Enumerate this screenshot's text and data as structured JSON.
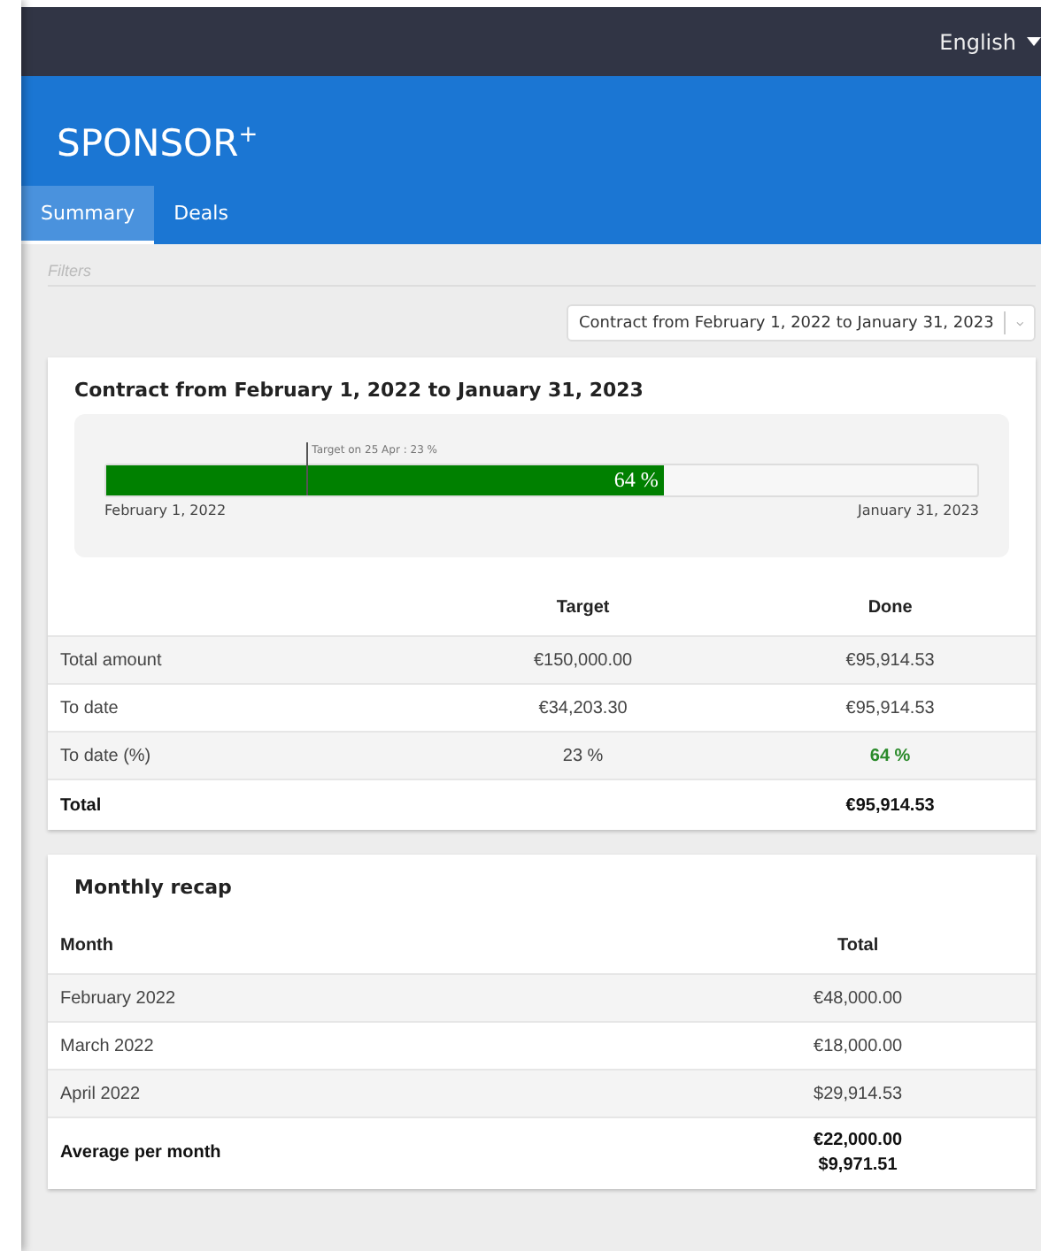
{
  "topbar": {
    "language": "English"
  },
  "header": {
    "brand": "SPONSOR",
    "brand_sup": "+"
  },
  "tabs": [
    {
      "label": "Summary",
      "selected": true
    },
    {
      "label": "Deals",
      "selected": false
    }
  ],
  "filters": {
    "label": "Filters",
    "contract_select": "Contract from February 1, 2022 to January 31, 2023"
  },
  "contract": {
    "title": "Contract from February 1, 2022 to January 31, 2023",
    "progress": {
      "level": 0.64,
      "label": "64 %",
      "target": {
        "level": 0.23,
        "label": "Target on 25 Apr : 23 %"
      },
      "start": "February 1, 2022",
      "end": "January 31, 2023"
    },
    "table": {
      "columns": [
        "Target",
        "Done"
      ],
      "rows": [
        {
          "label": "Total amount",
          "target": "€150,000.00",
          "done": "€95,914.53",
          "kind": "plain"
        },
        {
          "label": "To date",
          "target": "€34,203.30",
          "done": "€95,914.53",
          "kind": "plain"
        },
        {
          "label": "To date (%)",
          "target": "23 %",
          "done": "64 %",
          "kind": "percent"
        },
        {
          "label": "Total",
          "target": "",
          "done": "€95,914.53",
          "kind": "total"
        }
      ]
    }
  },
  "monthly": {
    "title": "Monthly recap",
    "columns": [
      "Month",
      "Total"
    ],
    "rows": [
      {
        "month": "February 2022",
        "total": [
          "€48,000.00"
        ],
        "kind": "plain"
      },
      {
        "month": "March 2022",
        "total": [
          "€18,000.00"
        ],
        "kind": "plain"
      },
      {
        "month": "April 2022",
        "total": [
          "$29,914.53"
        ],
        "kind": "plain"
      },
      {
        "month": "Average per month",
        "total": [
          "€22,000.00",
          "$9,971.51"
        ],
        "kind": "total"
      }
    ]
  }
}
